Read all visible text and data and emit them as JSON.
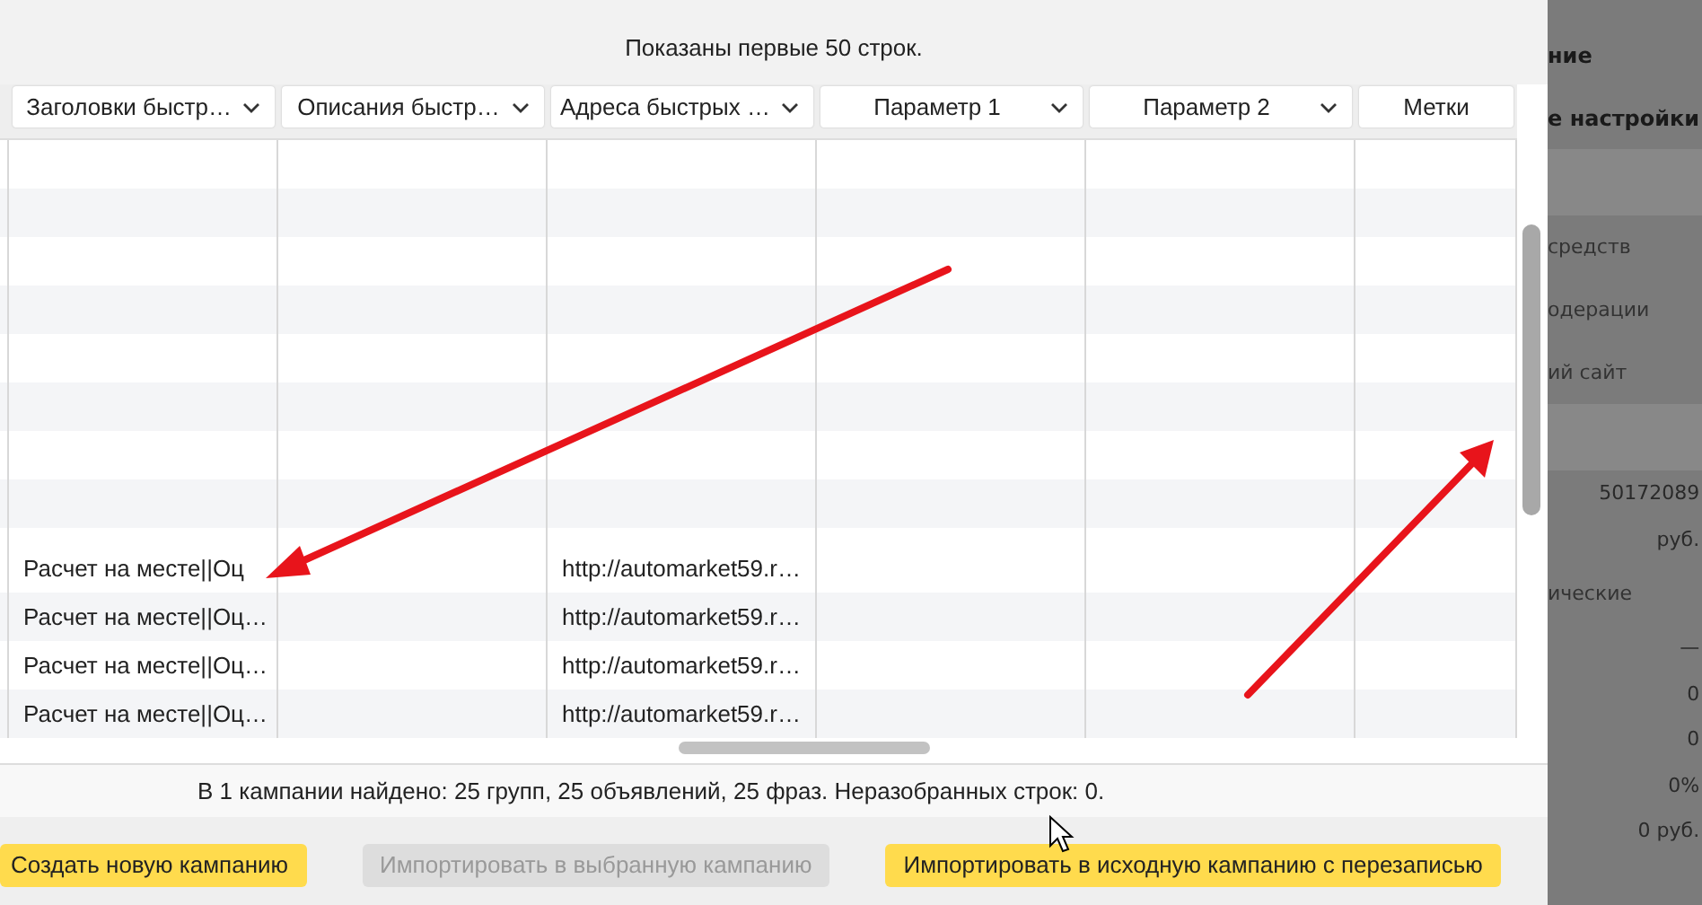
{
  "dialog": {
    "subtitle": "Показаны первые 50 строк.",
    "table": {
      "columns": [
        {
          "label": "Заголовки быстр…",
          "dropdown": true
        },
        {
          "label": "Описания быстр…",
          "dropdown": true
        },
        {
          "label": "Адреса быстрых …",
          "dropdown": true
        },
        {
          "label": "Параметр 1",
          "dropdown": true
        },
        {
          "label": "Параметр 2",
          "dropdown": true
        },
        {
          "label": "Метки",
          "dropdown": false
        }
      ],
      "rows": [
        {
          "sitelink_titles": "Расчет на месте||Оц",
          "sitelink_urls": "http://automarket59.r…"
        },
        {
          "sitelink_titles": "Расчет на месте||Оц…",
          "sitelink_urls": "http://automarket59.r…"
        },
        {
          "sitelink_titles": "Расчет на месте||Оц…",
          "sitelink_urls": "http://automarket59.r…"
        },
        {
          "sitelink_titles": "Расчет на месте||Оц…",
          "sitelink_urls": "http://automarket59.r…"
        }
      ]
    },
    "summary": "В 1 кампании найдено: 25 групп, 25 объявлений, 25 фраз. Неразобранных строк: 0.",
    "buttons": [
      {
        "label": "Создать новую кампанию",
        "disabled": false
      },
      {
        "label": "Импортировать в выбранную кампанию",
        "disabled": true
      },
      {
        "label": "Импортировать в исходную кампанию с перезаписью",
        "disabled": false
      }
    ]
  },
  "background_panel": {
    "items": [
      {
        "kind": "heading",
        "text": "ние"
      },
      {
        "kind": "heading",
        "text": "е настройки"
      },
      {
        "kind": "text",
        "text": "средств"
      },
      {
        "kind": "text",
        "text": "одерации"
      },
      {
        "kind": "text",
        "text": "ий сайт"
      },
      {
        "kind": "value",
        "text": "50172089"
      },
      {
        "kind": "value",
        "text": "руб."
      },
      {
        "kind": "text",
        "text": "ические"
      },
      {
        "kind": "value",
        "text": "—"
      },
      {
        "kind": "value",
        "text": "0"
      },
      {
        "kind": "value",
        "text": "0"
      },
      {
        "kind": "value",
        "text": "0%"
      },
      {
        "kind": "value",
        "text": "0 руб."
      }
    ]
  }
}
